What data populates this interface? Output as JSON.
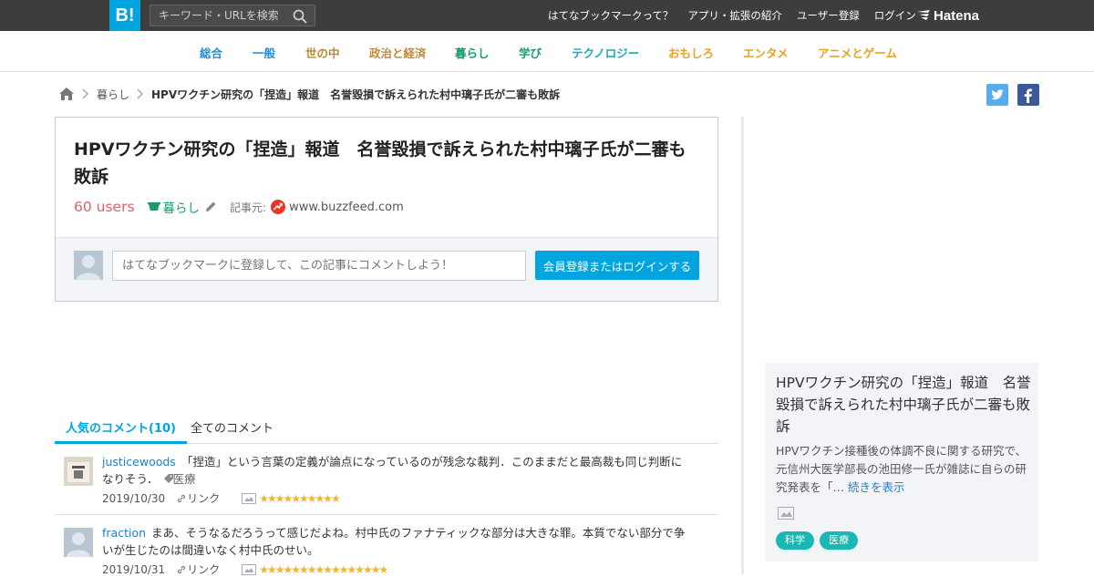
{
  "header": {
    "logo": "B!",
    "search_placeholder": "キーワード・URLを検索",
    "links": [
      "はてなブックマークって？",
      "アプリ・拡張の紹介",
      "ユーザー登録",
      "ログイン"
    ],
    "brand": "Hatena"
  },
  "categories": [
    {
      "label": "総合",
      "color": "#1e8fd0"
    },
    {
      "label": "一般",
      "color": "#1e8fd0"
    },
    {
      "label": "世の中",
      "color": "#b88a3a"
    },
    {
      "label": "政治と経済",
      "color": "#c08a3a"
    },
    {
      "label": "暮らし",
      "color": "#1a9b6e"
    },
    {
      "label": "学び",
      "color": "#1a9b6e"
    },
    {
      "label": "テクノロジー",
      "color": "#1aa8b8"
    },
    {
      "label": "おもしろ",
      "color": "#e8a21f"
    },
    {
      "label": "エンタメ",
      "color": "#e8a21f"
    },
    {
      "label": "アニメとゲーム",
      "color": "#e8a21f"
    }
  ],
  "breadcrumb": {
    "category": "暮らし",
    "current": "HPVワクチン研究の「捏造」報道　名誉毀損で訴えられた村中璃子氏が二審も敗訴"
  },
  "entry": {
    "title": "HPVワクチン研究の「捏造」報道　名誉毀損で訴えられた村中璃子氏が二審も敗訴",
    "users": "60 users",
    "category": "暮らし",
    "source_label": "記事元:",
    "source": "www.buzzfeed.com",
    "comment_placeholder": "はてなブックマークに登録して、この記事にコメントしよう！",
    "login_button": "会員登録またはログインする"
  },
  "tabs": {
    "popular": "人気のコメント(10)",
    "all": "全てのコメント"
  },
  "comments": [
    {
      "user": "justicewoods",
      "text": "「捏造」という言葉の定義が論点になっているのが残念な裁判．このままだと最高裁も同じ判断になりそう．",
      "tag": "医療",
      "date": "2019/10/30",
      "link_label": "リンク",
      "stars": "★★★★★★★★★★"
    },
    {
      "user": "fraction",
      "text": "まあ、そうなるだろうって感じだよね。村中氏のファナティックな部分は大きな罪。本質でない部分で争いが生じたのは間違いなく村中氏のせい。",
      "tag": "",
      "date": "2019/10/31",
      "link_label": "リンク",
      "stars": "★★★★★★★★★★★★★★★★"
    }
  ],
  "sidebar": {
    "title": "HPVワクチン研究の「捏造」報道　名誉毀損で訴えられた村中璃子氏が二審も敗訴",
    "description": "HPVワクチン接種後の体調不良に関する研究で、元信州大医学部長の池田修一氏が雑誌に自らの研究発表を「…",
    "more": "続きを表示",
    "tags": [
      "科学",
      "医療"
    ]
  },
  "colors": {
    "accent": "#00a4de",
    "users": "#e95b68",
    "topbar": "#3d3d3d"
  }
}
